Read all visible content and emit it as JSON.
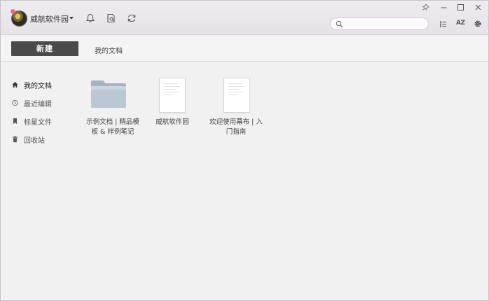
{
  "user": {
    "name": "威航软件园"
  },
  "toolbar": {
    "new_label": "新建",
    "breadcrumb": "我的文档"
  },
  "search": {
    "placeholder": "",
    "value": ""
  },
  "sort_label": "AZ",
  "sidebar": {
    "items": [
      {
        "label": "我的文档",
        "icon": "home-icon",
        "active": true
      },
      {
        "label": "最近编辑",
        "icon": "clock-icon",
        "active": false
      },
      {
        "label": "标星文件",
        "icon": "bookmark-icon",
        "active": false
      },
      {
        "label": "回收站",
        "icon": "trash-icon",
        "active": false
      }
    ]
  },
  "files": [
    {
      "type": "folder",
      "name_line1": "示例文档 | 精品模",
      "name_line2": "板 & 样例笔记"
    },
    {
      "type": "document",
      "name_line1": "威航软件园",
      "name_line2": ""
    },
    {
      "type": "document",
      "name_line1": "欢迎使用幕布 | 入",
      "name_line2": "门指南"
    }
  ],
  "colors": {
    "accent": "#4a4a4a",
    "titlebar": "#e9e5ea",
    "background": "#f1f1f1",
    "folder": "#b7c2d1"
  }
}
